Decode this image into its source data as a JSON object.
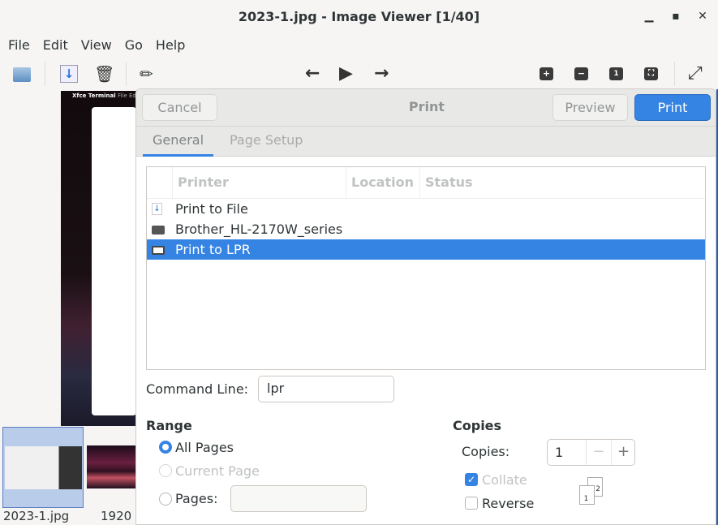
{
  "window": {
    "title": "2023-1.jpg - Image Viewer [1/40]",
    "controls": [
      "minimize",
      "maximize",
      "close"
    ]
  },
  "menubar": [
    "File",
    "Edit",
    "View",
    "Go",
    "Help"
  ],
  "toolbar": {
    "icons": [
      "folder-open-icon",
      "save-icon",
      "trash-icon",
      "edit-pencil-icon",
      "arrow-left-icon",
      "play-icon",
      "arrow-right-icon",
      "zoom-in-icon",
      "zoom-out-icon",
      "zoom-100-icon",
      "zoom-fit-icon",
      "fullscreen-icon"
    ],
    "zoom_100_label": "1"
  },
  "image_preview": {
    "terminal_title": "Xfce Terminal",
    "menu": "File  Ed"
  },
  "thumbnails": [
    {
      "label": "2023-1.jpg",
      "selected": true
    },
    {
      "label": "1920"
    }
  ],
  "dialog": {
    "title": "Print",
    "cancel": "Cancel",
    "preview": "Preview",
    "print": "Print",
    "tabs": [
      {
        "label": "General",
        "active": true
      },
      {
        "label": "Page Setup",
        "active": false
      }
    ],
    "printer_columns": [
      "Printer",
      "Location",
      "Status"
    ],
    "printers": [
      {
        "name": "Print to File",
        "icon": "file-download-icon",
        "selected": false
      },
      {
        "name": "Brother_HL-2170W_series",
        "icon": "printer-icon",
        "selected": false
      },
      {
        "name": "Print to LPR",
        "icon": "printer-icon",
        "selected": true
      }
    ],
    "command_line_label": "Command Line:",
    "command_line_value": "lpr",
    "range": {
      "heading": "Range",
      "all_pages": "All Pages",
      "current_page": "Current Page",
      "pages": "Pages:",
      "pages_value": "",
      "selected": "All Pages"
    },
    "copies": {
      "heading": "Copies",
      "label": "Copies:",
      "value": "1",
      "minus": "−",
      "plus": "+",
      "collate": "Collate",
      "collate_checked": true,
      "reverse": "Reverse",
      "reverse_checked": false,
      "page_1": "1",
      "page_2": "2"
    }
  },
  "colors": {
    "accent": "#3584e4"
  }
}
